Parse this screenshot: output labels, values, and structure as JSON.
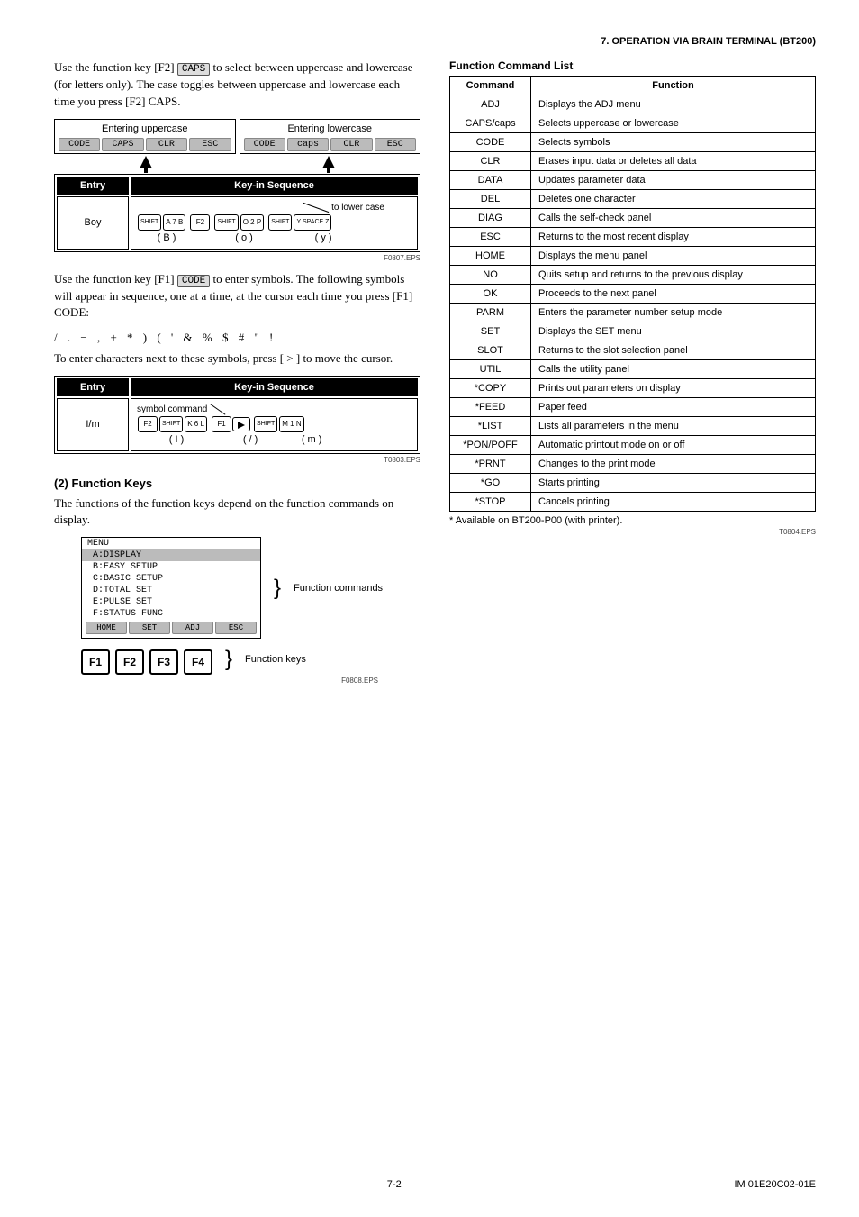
{
  "header": {
    "section": "7.  OPERATION VIA BRAIN TERMINAL (BT200)"
  },
  "left": {
    "para1_a": "Use the function key [F2] ",
    "para1_key": "CAPS",
    "para1_b": " to select between uppercase and lowercase (for letters only). The case toggles between uppercase and lowercase each time you press [F2] CAPS.",
    "fig1": {
      "entering_upper": "Entering uppercase",
      "entering_lower": "Entering lowercase",
      "toolbar_upper": [
        "CODE",
        "CAPS",
        "CLR",
        "ESC"
      ],
      "toolbar_lower": [
        "CODE",
        "caps",
        "CLR",
        "ESC"
      ],
      "entry_hdr": "Entry",
      "seq_hdr": "Key-in Sequence",
      "row_entry": "Boy",
      "annot": "to lower case",
      "keys1": [
        "SHIFT",
        "A 7 B",
        "F2",
        "SHIFT",
        "O 2 P",
        "SHIFT",
        "Y SPACE Z"
      ],
      "letters": [
        "( B )",
        "( o )",
        "( y )"
      ],
      "label": "F0807.EPS"
    },
    "para2_a": "Use the function key [F1] ",
    "para2_key": "CODE",
    "para2_b": " to enter symbols. The following symbols will appear in sequence, one at a time, at the cursor each time you press [F1] CODE:",
    "symbols": "/ . − , + * ) ( ' & % $ # \" !",
    "para3": "To enter characters next to these symbols, press [ > ] to move the cursor.",
    "fig2": {
      "entry_hdr": "Entry",
      "seq_hdr": "Key-in Sequence",
      "row_entry": "I/m",
      "annot": "symbol command",
      "keys": [
        "F2",
        "SHIFT",
        "K 6 L",
        "F1",
        ">",
        "SHIFT",
        "M 1 N"
      ],
      "letters": [
        "( I )",
        "( / )",
        "( m )"
      ],
      "label": "T0803.EPS"
    },
    "h3": "(2)  Function Keys",
    "para4": "The functions of the function keys depend on the function commands on display.",
    "panel": {
      "lines": [
        "MENU",
        " A:DISPLAY",
        " B:EASY SETUP",
        " C:BASIC SETUP",
        " D:TOTAL SET",
        " E:PULSE SET",
        " F:STATUS FUNC"
      ],
      "highlight_index": 1,
      "toolbar": [
        "HOME",
        "SET",
        "ADJ",
        "ESC"
      ],
      "cmd_label": "Function commands",
      "fkeys": [
        "F1",
        "F2",
        "F3",
        "F4"
      ],
      "fkey_label": "Function keys",
      "label": "F0808.EPS"
    }
  },
  "right": {
    "title": "Function Command List",
    "th1": "Command",
    "th2": "Function",
    "rows": [
      [
        "ADJ",
        "Displays the ADJ menu"
      ],
      [
        "CAPS/caps",
        "Selects uppercase or lowercase"
      ],
      [
        "CODE",
        "Selects symbols"
      ],
      [
        "CLR",
        "Erases input data or deletes all data"
      ],
      [
        "DATA",
        "Updates parameter data"
      ],
      [
        "DEL",
        "Deletes one character"
      ],
      [
        "DIAG",
        "Calls the self-check panel"
      ],
      [
        "ESC",
        "Returns to the most recent display"
      ],
      [
        "HOME",
        "Displays the menu panel"
      ],
      [
        "NO",
        "Quits setup and returns to the previous display"
      ],
      [
        "OK",
        "Proceeds to the next panel"
      ],
      [
        "PARM",
        "Enters the parameter number setup mode"
      ],
      [
        "SET",
        "Displays the SET menu"
      ],
      [
        "SLOT",
        "Returns to the slot selection panel"
      ],
      [
        "UTIL",
        "Calls the utility panel"
      ],
      [
        "*COPY",
        "Prints out parameters on display"
      ],
      [
        "*FEED",
        "Paper feed"
      ],
      [
        "*LIST",
        "Lists all parameters in the menu"
      ],
      [
        "*PON/POFF",
        "Automatic printout mode on or off"
      ],
      [
        "*PRNT",
        "Changes to the print  mode"
      ],
      [
        "*GO",
        "Starts printing"
      ],
      [
        "*STOP",
        "Cancels printing"
      ]
    ],
    "footnote": "* Available on BT200-P00 (with printer).",
    "label": "T0804.EPS"
  },
  "footer": {
    "page": "7-2",
    "doc": "IM 01E20C02-01E"
  }
}
